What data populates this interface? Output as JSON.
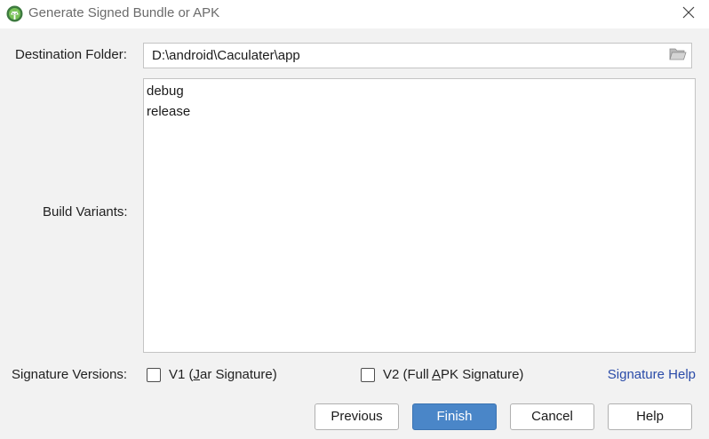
{
  "window": {
    "title": "Generate Signed Bundle or APK"
  },
  "destination": {
    "label": "Destination Folder:",
    "value": "D:\\android\\Caculater\\app"
  },
  "build_variants": {
    "label": "Build Variants:",
    "items": [
      "debug",
      "release"
    ]
  },
  "signature": {
    "label": "Signature Versions:",
    "v1": {
      "prefix": "V1 (",
      "mnemonic": "J",
      "suffix": "ar Signature)",
      "checked": false
    },
    "v2": {
      "prefix": "V2 (Full ",
      "mnemonic": "A",
      "suffix": "PK Signature)",
      "checked": false
    },
    "help_link": "Signature Help"
  },
  "buttons": {
    "previous": "Previous",
    "finish": "Finish",
    "cancel": "Cancel",
    "help": "Help"
  },
  "icons": {
    "app": "android-studio-icon",
    "close": "close-icon",
    "folder": "folder-open-icon"
  },
  "colors": {
    "primary_button": "#4a86c8",
    "link": "#2a4ba8",
    "background": "#f2f2f2"
  }
}
